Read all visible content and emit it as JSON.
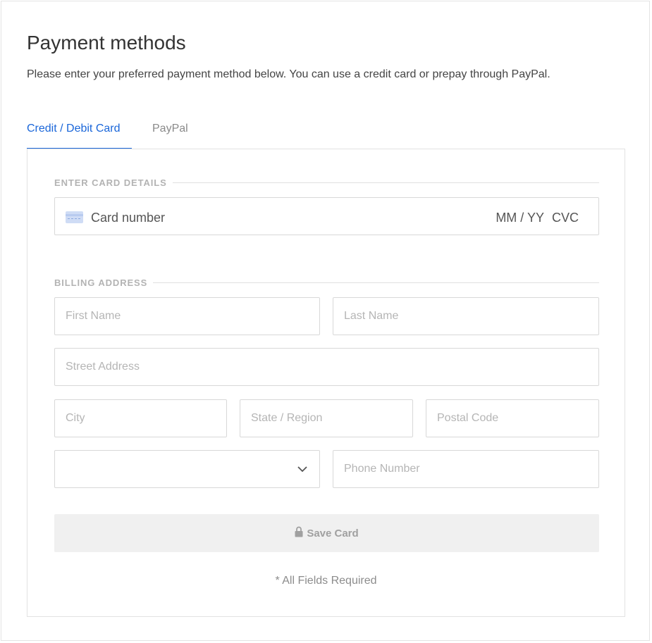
{
  "header": {
    "title": "Payment methods",
    "subtitle": "Please enter your preferred payment method below. You can use a credit card or prepay through PayPal."
  },
  "tabs": [
    {
      "label": "Credit / Debit Card",
      "active": true
    },
    {
      "label": "PayPal",
      "active": false
    }
  ],
  "card_section": {
    "heading": "ENTER CARD DETAILS",
    "card_number_placeholder": "Card number",
    "expiry_placeholder": "MM / YY",
    "cvc_placeholder": "CVC",
    "icon": "credit-card-icon"
  },
  "billing_section": {
    "heading": "BILLING ADDRESS",
    "first_name_placeholder": "First Name",
    "last_name_placeholder": "Last Name",
    "street_placeholder": "Street Address",
    "city_placeholder": "City",
    "state_placeholder": "State / Region",
    "postal_placeholder": "Postal Code",
    "country_value": "",
    "phone_placeholder": "Phone Number"
  },
  "actions": {
    "save_label": "Save Card",
    "save_icon": "lock-icon",
    "required_note": "* All Fields Required"
  },
  "colors": {
    "accent": "#1a66d9",
    "border": "#d8d8d8",
    "muted_text": "#b5b5b5",
    "button_bg": "#f0f0f0"
  }
}
